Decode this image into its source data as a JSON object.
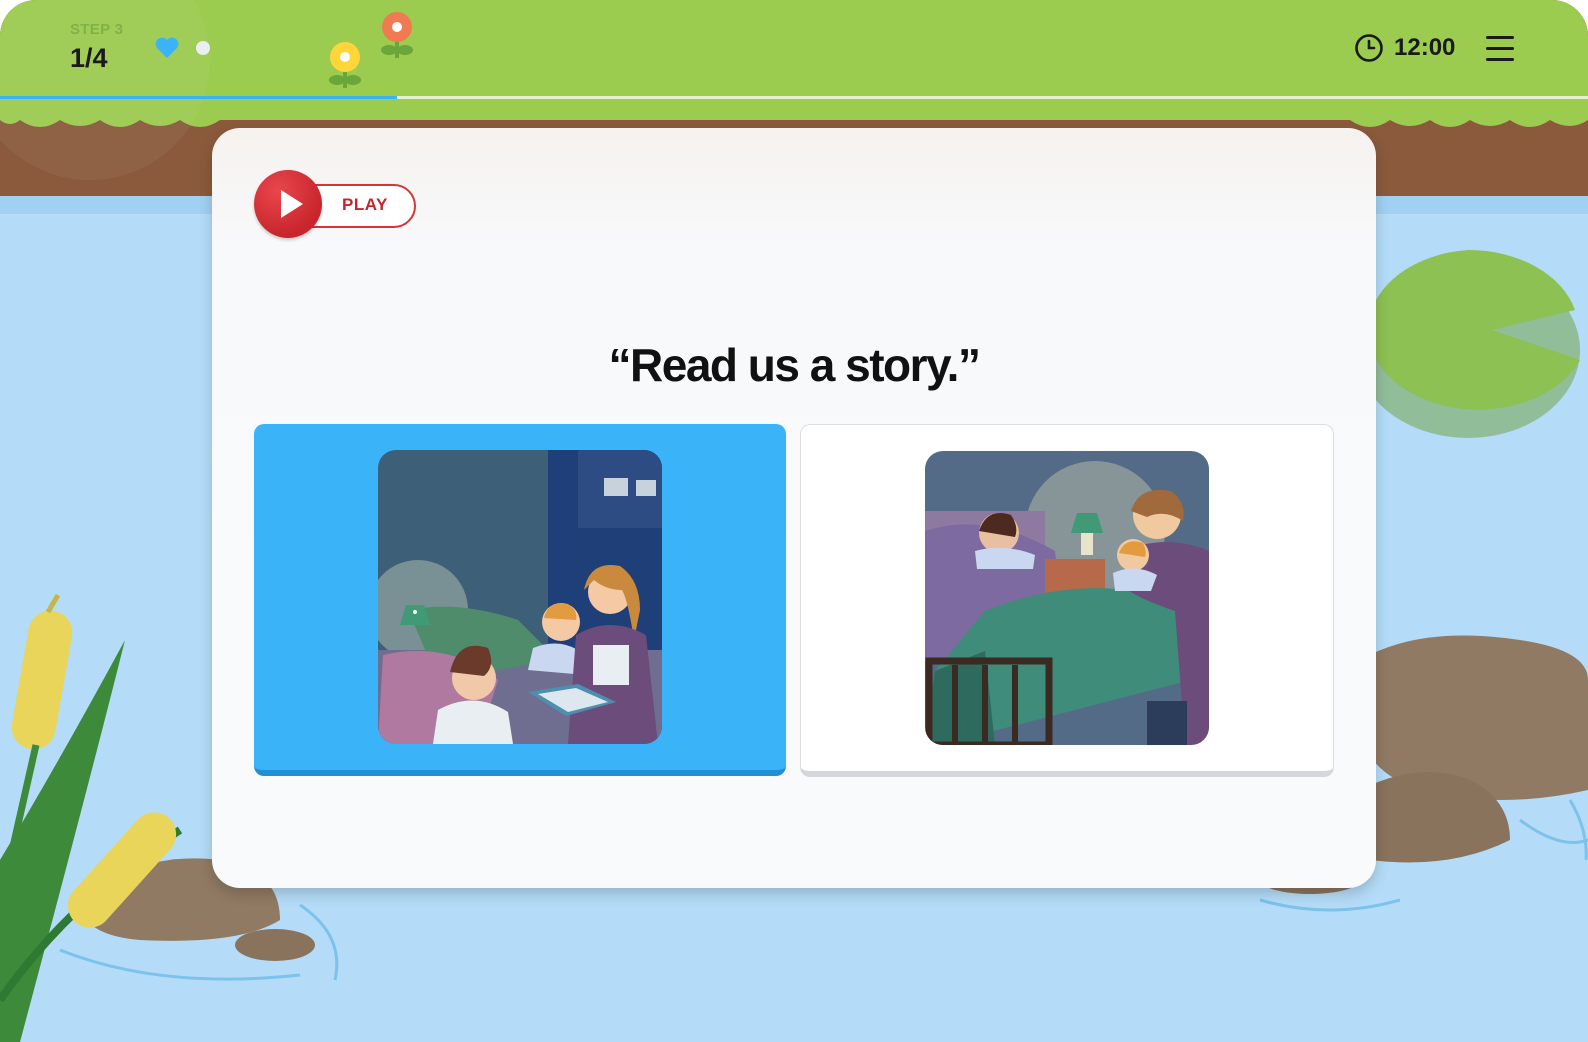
{
  "header": {
    "step_label": "STEP 3",
    "step_count": "1/4",
    "progress": 0.25,
    "timer": "12:00"
  },
  "icons": {
    "heart": "heart-icon",
    "clock": "clock-icon",
    "menu": "hamburger-menu-icon",
    "play": "play-icon"
  },
  "audio": {
    "play_label": "PLAY"
  },
  "question": {
    "prompt": "“Read us a story.”"
  },
  "choices": [
    {
      "illustration": "mother reading a book to two children at bedtime",
      "selected": true
    },
    {
      "illustration": "parent holding baby beside a child yawning in bed",
      "selected": false
    }
  ],
  "colors": {
    "accent": "#3BB3F8",
    "play_red": "#D6333B",
    "grass": "#9BCB4F",
    "water": "#B4DCF8"
  }
}
